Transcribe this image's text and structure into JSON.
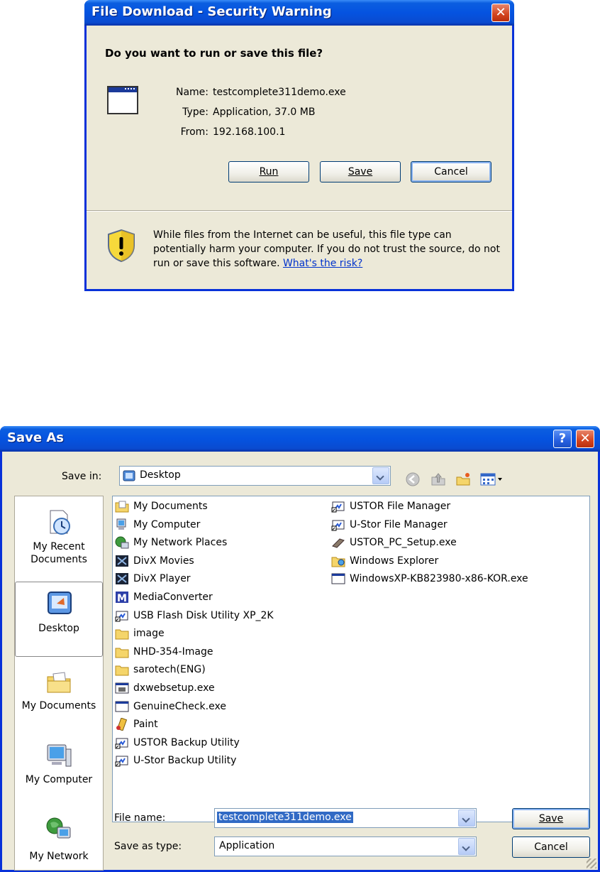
{
  "download": {
    "title": "File Download - Security Warning",
    "question": "Do you want to run or save this file?",
    "name_label": "Name:",
    "name_value": "testcomplete311demo.exe",
    "type_label": "Type:",
    "type_value": "Application, 37.0 MB",
    "from_label": "From:",
    "from_value": "192.168.100.1",
    "run_button": "Run",
    "save_button": "Save",
    "cancel_button": "Cancel",
    "warning_text": "While files from the Internet can be useful, this file type can potentially harm your computer. If you do not trust the source, do not run or save this software.",
    "risk_link": "What's the risk?",
    "close_glyph": "✕"
  },
  "saveas": {
    "title": "Save As",
    "help_glyph": "?",
    "close_glyph": "✕",
    "save_in_label": "Save in:",
    "save_in_value": "Desktop",
    "places": [
      {
        "label": "My Recent Documents",
        "icon": "recent-documents-icon"
      },
      {
        "label": "Desktop",
        "icon": "desktop-icon"
      },
      {
        "label": "My Documents",
        "icon": "my-documents-icon"
      },
      {
        "label": "My Computer",
        "icon": "my-computer-icon"
      },
      {
        "label": "My Network",
        "icon": "my-network-icon"
      }
    ],
    "files_col1": [
      {
        "name": "My Documents",
        "icon": "folder-docs-icon"
      },
      {
        "name": "My Computer",
        "icon": "computer-icon"
      },
      {
        "name": "My Network Places",
        "icon": "network-icon"
      },
      {
        "name": "DivX Movies",
        "icon": "divx-icon"
      },
      {
        "name": "DivX Player",
        "icon": "divx-icon"
      },
      {
        "name": "MediaConverter",
        "icon": "media-converter-icon"
      },
      {
        "name": "USB Flash Disk Utility XP_2K",
        "icon": "shortcut-app-icon"
      },
      {
        "name": "image",
        "icon": "folder-icon"
      },
      {
        "name": "NHD-354-Image",
        "icon": "folder-icon"
      },
      {
        "name": "sarotech(ENG)",
        "icon": "folder-icon"
      },
      {
        "name": "dxwebsetup.exe",
        "icon": "exe-setup-icon"
      },
      {
        "name": "GenuineCheck.exe",
        "icon": "exe-icon"
      },
      {
        "name": "Paint",
        "icon": "paint-icon"
      },
      {
        "name": "USTOR Backup Utility",
        "icon": "shortcut-app-icon"
      },
      {
        "name": "U-Stor Backup Utility",
        "icon": "shortcut-app-icon"
      }
    ],
    "files_col2": [
      {
        "name": "USTOR File Manager",
        "icon": "shortcut-app-icon"
      },
      {
        "name": "U-Stor File Manager",
        "icon": "shortcut-app-icon"
      },
      {
        "name": "USTOR_PC_Setup.exe",
        "icon": "setup-icon"
      },
      {
        "name": "Windows Explorer",
        "icon": "explorer-icon"
      },
      {
        "name": "WindowsXP-KB823980-x86-KOR.exe",
        "icon": "exe-icon"
      }
    ],
    "file_name_label": "File name:",
    "file_name_value": "testcomplete311demo.exe",
    "save_type_label": "Save as type:",
    "save_type_value": "Application",
    "save_button": "Save",
    "cancel_button": "Cancel"
  }
}
